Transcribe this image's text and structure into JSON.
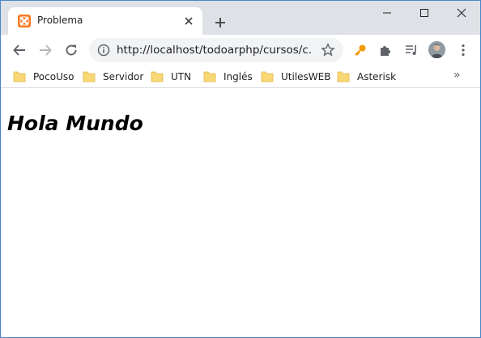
{
  "tab": {
    "title": "Problema",
    "favicon": "xampp-icon"
  },
  "address_bar": {
    "url": "http://localhost/todoarphp/cursos/c..."
  },
  "bookmarks": [
    {
      "label": "PocoUso"
    },
    {
      "label": "Servidor"
    },
    {
      "label": "UTN"
    },
    {
      "label": "Inglés"
    },
    {
      "label": "UtilesWEB"
    },
    {
      "label": "Asterisk"
    }
  ],
  "bookmarks_more": "»",
  "page": {
    "heading": "Hola Mundo"
  },
  "colors": {
    "tabstrip": "#dee1e6",
    "favicon": "#fb7a24",
    "folder": "#f8d775",
    "key": "#f29900"
  }
}
